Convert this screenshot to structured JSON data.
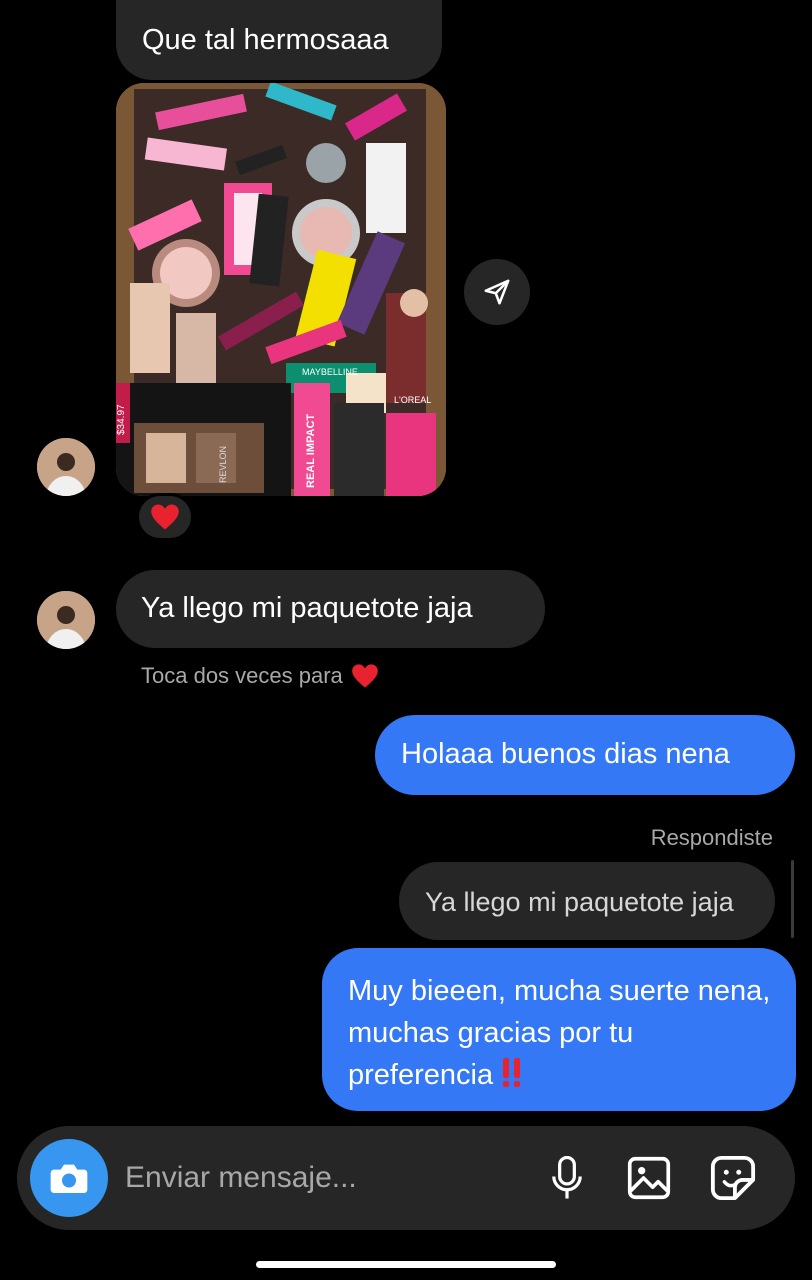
{
  "messages": {
    "greeting": "Que tal hermosaaa",
    "arrived": "Ya llego mi paquetote jaja",
    "hello": "Holaaa buenos dias nena",
    "reply_quote": "Ya llego mi paquetote jaja",
    "thanks": "Muy bieeen, mucha suerte nena, muchas gracias por tu preferencia"
  },
  "hint": {
    "text": "Toca dos veces para"
  },
  "replied_label": "Respondiste",
  "composer": {
    "placeholder": "Enviar mensaje..."
  },
  "photo": {
    "price_tag": "$34.97",
    "brand_labels": [
      "REAL IMPACT",
      "MAYBELLINE",
      "L'OREAL",
      "REVLON"
    ]
  },
  "icons": [
    "share-arrow-icon",
    "heart-icon",
    "double-exclamation-icon",
    "camera-icon",
    "microphone-icon",
    "gallery-icon",
    "sticker-icon"
  ],
  "colors": {
    "outgoing": "#3478f6",
    "incoming": "#262626",
    "camera": "#3797f0"
  }
}
